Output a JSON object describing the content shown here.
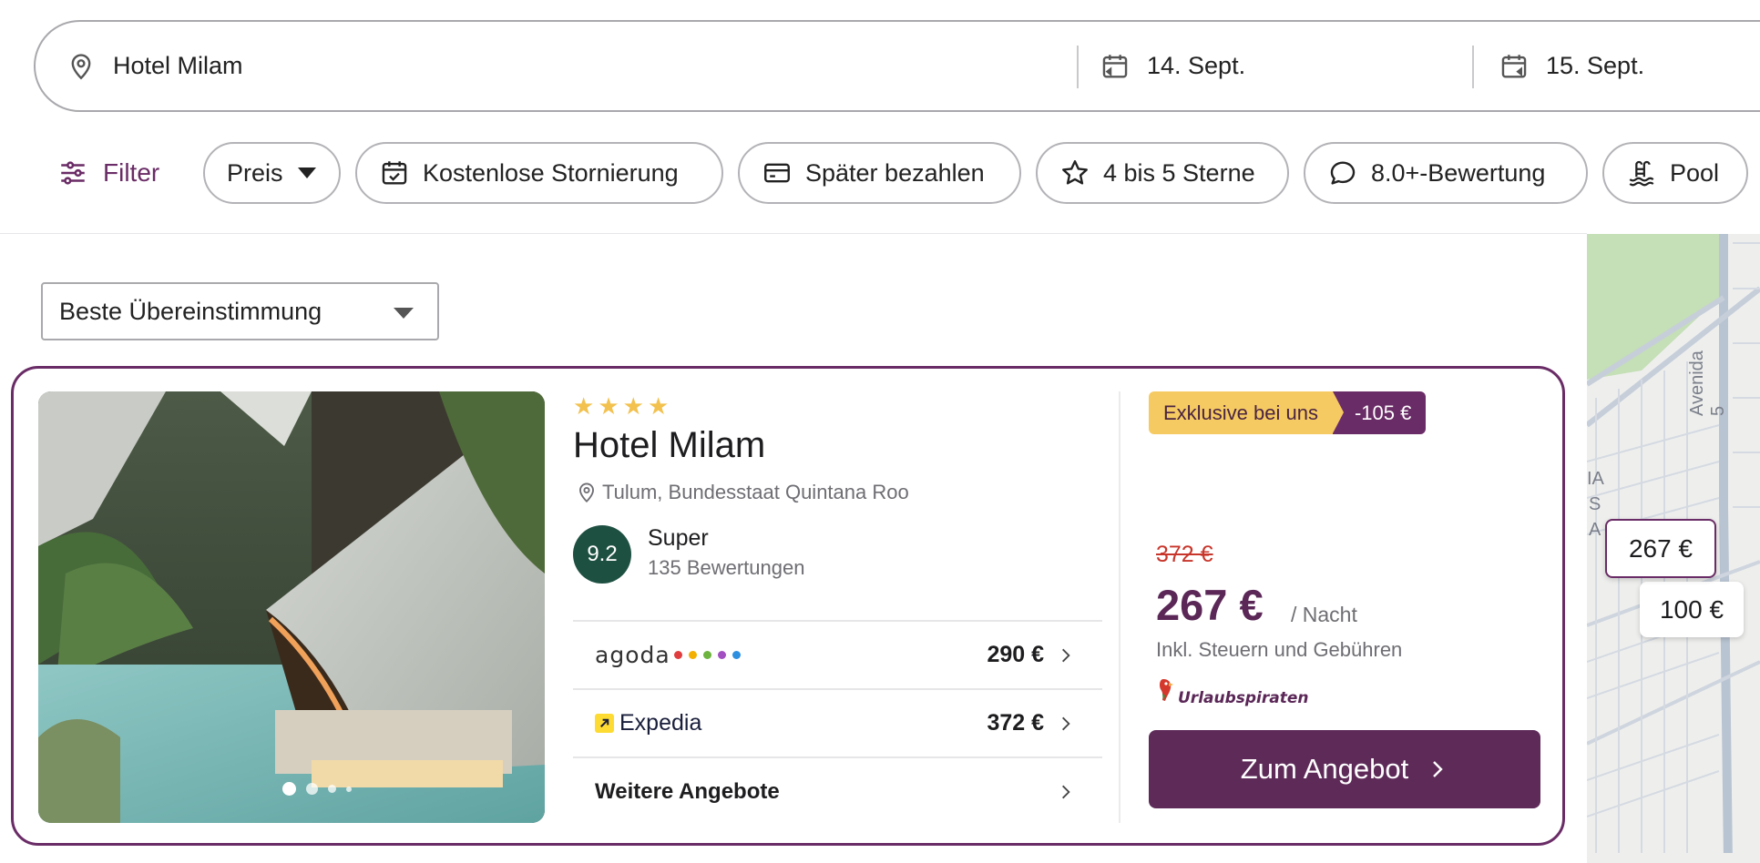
{
  "search": {
    "destination": "Hotel Milam",
    "checkin": "14. Sept.",
    "checkout": "15. Sept."
  },
  "filters": {
    "filter_label": "Filter",
    "chips": [
      "Preis",
      "Kostenlose Stornierung",
      "Später bezahlen",
      "4 bis 5 Sterne",
      "8.0+-Bewertung",
      "Pool"
    ]
  },
  "sort": {
    "selected": "Beste Übereinstimmung"
  },
  "hotel": {
    "stars": 4,
    "name": "Hotel Milam",
    "location": "Tulum, Bundesstaat Quintana Roo",
    "rating": "9.2",
    "rating_label": "Super",
    "reviews": "135 Bewertungen",
    "photo_count_dots": 4,
    "photo_active_index": 0,
    "providers": [
      {
        "name": "agoda",
        "price": "290 €"
      },
      {
        "name": "Expedia",
        "price": "372 €"
      }
    ],
    "more_offers": "Weitere Angebote",
    "badge_label": "Exklusive bei uns",
    "badge_discount": "-105 €",
    "old_price": "372 €",
    "price": "267 €",
    "per_night": "/ Nacht",
    "taxes_note": "Inkl. Steuern und Gebühren",
    "partner": "Urlaubspiraten",
    "cta": "Zum Angebot"
  },
  "map": {
    "street_label": "Avenida 5",
    "pins": [
      "267 €",
      "100 €"
    ],
    "area_label_lines": [
      "IA",
      "S",
      "A"
    ]
  },
  "colors": {
    "brand_purple": "#6a2c66",
    "price_purple": "#5a2757",
    "badge_yellow": "#f6ca62",
    "rating_green": "#1e5042",
    "strike_red": "#c8352a",
    "star_yellow": "#f2c14e"
  },
  "icons": {
    "search_location": "location-pin-icon",
    "checkin": "calendar-icon",
    "checkout": "calendar-icon",
    "filter": "sliders-icon",
    "storno": "calendar-check-icon",
    "spaeter": "credit-card-icon",
    "sterne": "star-outline-icon",
    "bewertung": "speech-bubble-icon",
    "pool": "pool-icon"
  }
}
